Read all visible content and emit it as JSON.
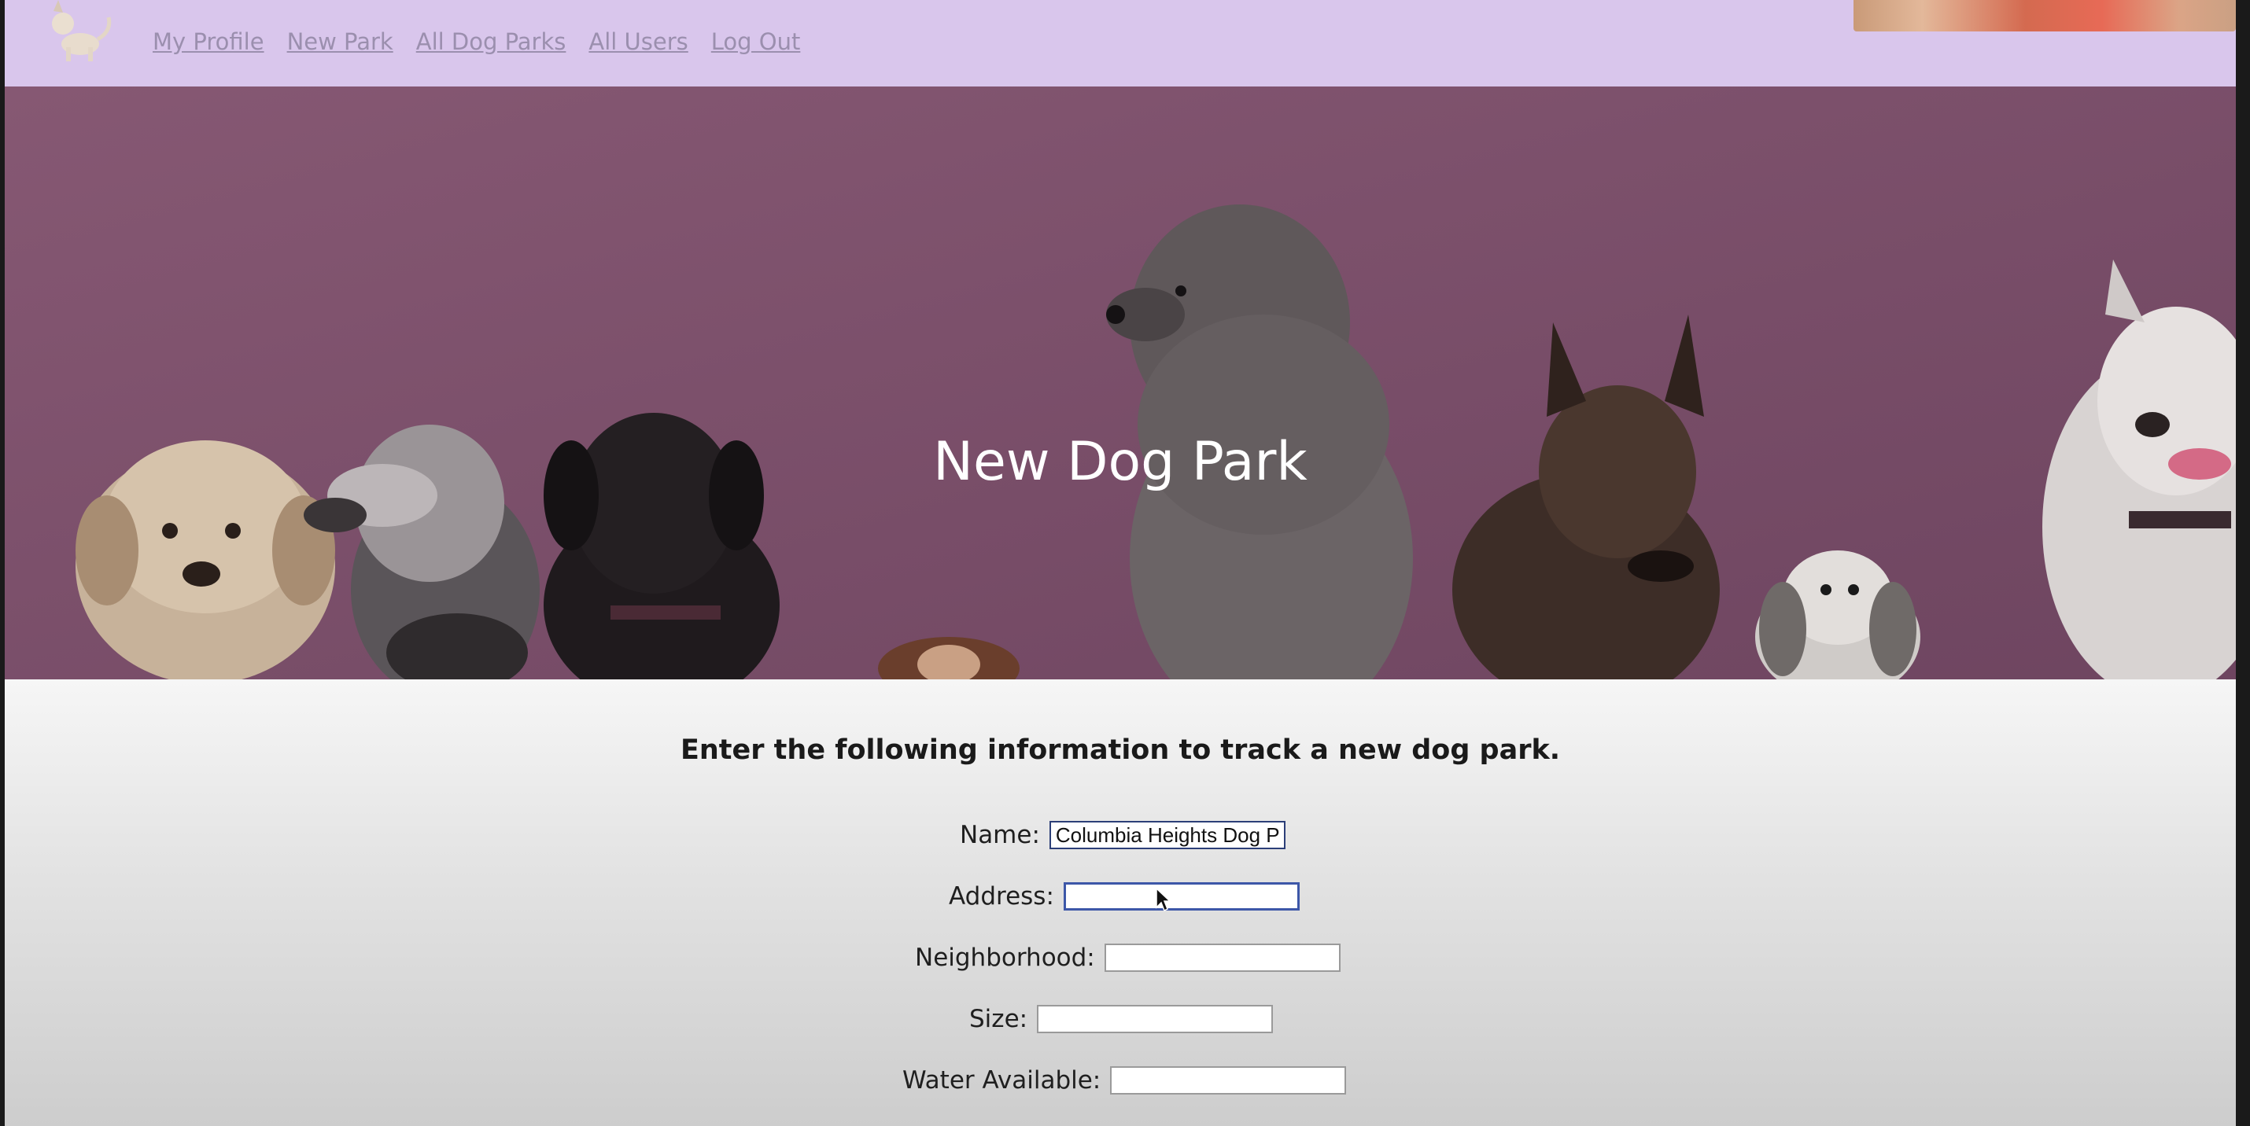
{
  "nav": {
    "links": [
      "My Profile",
      "New Park",
      "All Dog Parks",
      "All Users",
      "Log Out"
    ],
    "logo_icon": "dog-logo-icon"
  },
  "hero": {
    "title": "New Dog Park"
  },
  "form": {
    "intro": "Enter the following information to track a new dog park.",
    "fields": [
      {
        "label": "Name:",
        "value": "Columbia Heights Dog P",
        "placeholder": ""
      },
      {
        "label": "Address:",
        "value": "",
        "placeholder": ""
      },
      {
        "label": "Neighborhood:",
        "value": "",
        "placeholder": ""
      },
      {
        "label": "Size:",
        "value": "",
        "placeholder": ""
      },
      {
        "label": "Water Available:",
        "value": "",
        "placeholder": ""
      }
    ]
  },
  "colors": {
    "navbar": "#d9c6ec",
    "hero_bg": "#7c4f6c",
    "link": "#9b8fae",
    "focus_border": "#3d57a8"
  }
}
